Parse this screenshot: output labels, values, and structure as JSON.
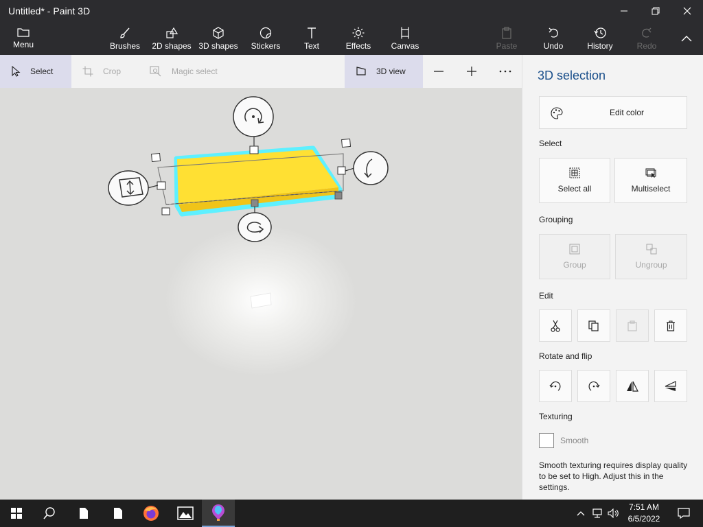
{
  "window": {
    "title": "Untitled* - Paint 3D",
    "controls": [
      "minimize-icon",
      "restore-icon",
      "close-icon"
    ]
  },
  "ribbon": {
    "menu": "Menu",
    "brushes": "Brushes",
    "shapes2d": "2D shapes",
    "shapes3d": "3D shapes",
    "stickers": "Stickers",
    "text": "Text",
    "effects": "Effects",
    "canvas": "Canvas",
    "paste": "Paste",
    "undo": "Undo",
    "history": "History",
    "redo": "Redo"
  },
  "toolbar": {
    "select": "Select",
    "crop": "Crop",
    "magic_select": "Magic select",
    "view3d": "3D view"
  },
  "panel": {
    "title": "3D selection",
    "edit_color": "Edit color",
    "select_label": "Select",
    "select_all": "Select all",
    "multiselect": "Multiselect",
    "grouping_label": "Grouping",
    "group": "Group",
    "ungroup": "Ungroup",
    "edit_label": "Edit",
    "rotate_label": "Rotate and flip",
    "texturing_label": "Texturing",
    "smooth": "Smooth",
    "note": "Smooth texturing requires display quality to be set to High. Adjust this in the settings."
  },
  "taskbar": {
    "time": "7:51 AM",
    "date": "6/5/2022"
  },
  "colors": {
    "object": "#ffe033",
    "highlight": "#5ef0ff",
    "accent": "#1a4f8b"
  }
}
